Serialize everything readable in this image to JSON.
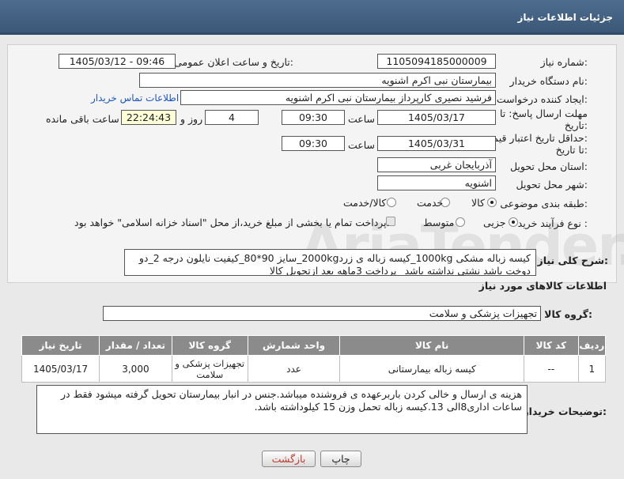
{
  "header": {
    "title": "جزئیات اطلاعات نیاز"
  },
  "form": {
    "need_number": {
      "label": "شماره نیاز:",
      "value": "1105094185000009"
    },
    "announce": {
      "label": "تاریخ و ساعت اعلان عمومی:",
      "value": "1405/03/12 - 09:46"
    },
    "buyer_org": {
      "label": "نام دستگاه خریدار:",
      "value": "بیمارستان نبی اکرم اشنویه"
    },
    "creator": {
      "label": "ایجاد کننده درخواست:",
      "value": "فرشید نصیری کارپرداز بیمارستان نبی اکرم اشنویه",
      "contact_link": "اطلاعات تماس خریدار"
    },
    "deadline": {
      "label_line1": "مهلت ارسال پاسخ: تا",
      "label_line2": "تاریخ:",
      "date": "1405/03/17",
      "time_label": "ساعت",
      "time": "09:30",
      "days": "4",
      "days_label": "روز و",
      "remaining": "22:24:43",
      "remaining_label": "ساعت باقی مانده"
    },
    "validity": {
      "label_line1": "حداقل تاریخ اعتبار قیمت:",
      "label_line2": "تا تاریخ:",
      "date": "1405/03/31",
      "time_label": "ساعت",
      "time": "09:30"
    },
    "province": {
      "label": "استان محل تحویل:",
      "value": "آذربایجان غربی"
    },
    "city": {
      "label": "شهر محل تحویل:",
      "value": "اشنویه"
    },
    "category": {
      "label": "طبقه بندی موضوعی:",
      "options": [
        "کالا",
        "خدمت",
        "کالا/خدمت"
      ],
      "selected": "کالا"
    },
    "purchase_type": {
      "label": "نوع فرآیند خرید :",
      "options": [
        "جزیی",
        "متوسط"
      ],
      "selected": "جزیی",
      "treasury_note": "پرداخت تمام یا بخشی از مبلغ خرید،از محل \"اسناد خزانه اسلامی\" خواهد بود."
    },
    "general_desc": {
      "label": "شرح کلی نیاز:",
      "value": "کیسه زباله مشکی 1000kg_کیسه زباله ی زرد2000kg_سایز 90*80_کیفیت نایلون درجه 2_دو دوخت باشد نشتی نداشته باشد_ پرداخت 3ماهه بعد ازتحویل کالا"
    }
  },
  "goods": {
    "section_title": "اطلاعات کالاهای مورد نیاز",
    "group_label": "گروه کالا:",
    "group_value": "تجهیزات پزشکی و سلامت",
    "table": {
      "headers": [
        "ردیف",
        "کد کالا",
        "نام کالا",
        "واحد شمارش",
        "گروه کالا",
        "تعداد / مقدار",
        "تاریخ نیاز"
      ],
      "rows": [
        [
          "1",
          "--",
          "کیسه زباله بیمارستانی",
          "عدد",
          "تجهیزات پزشکی و سلامت",
          "3,000",
          "1405/03/17"
        ]
      ]
    }
  },
  "buyer_notes": {
    "label": "توضیحات خریدار:",
    "value": "هزینه ی ارسال و خالی کردن باربرعهده ی فروشنده میباشد.جنس در انبار بیمارستان تحویل گرفته میشود فقط در ساعات اداری8الی 13.کیسه زباله تحمل وزن 15 کیلوداشته باشد."
  },
  "buttons": {
    "print": "چاپ",
    "back": "بازگشت"
  },
  "watermark": "AriaTender.net"
}
